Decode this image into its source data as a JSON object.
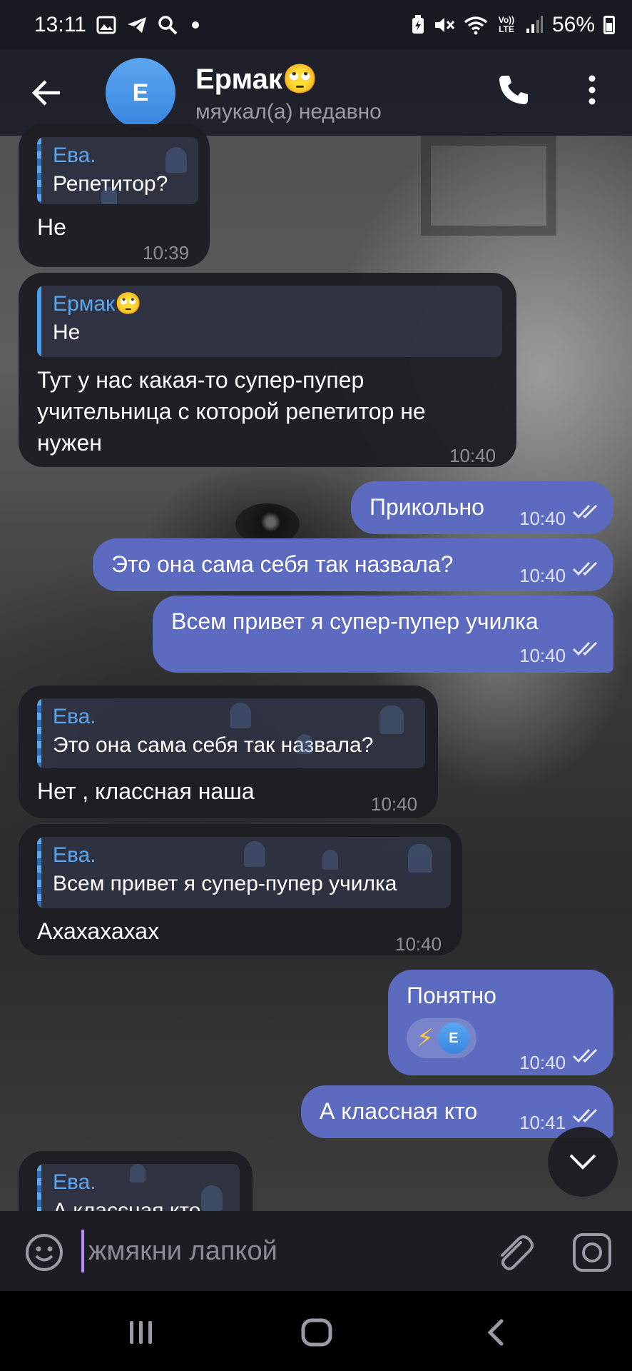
{
  "status_bar": {
    "time": "13:11",
    "battery": "56%",
    "left_icons": [
      "image-icon",
      "telegram-icon",
      "search-icon",
      "dot-icon"
    ],
    "right_icons": [
      "battery-saver-icon",
      "mute-icon",
      "wifi-icon",
      "volte-icon",
      "signal-icon"
    ],
    "volte_label": "Vo)) LTE"
  },
  "header": {
    "avatar_letter": "E",
    "title": "Ермак🙄",
    "subtitle": "мяукал(а) недавно"
  },
  "messages": [
    {
      "type": "incoming",
      "reply_name": "Ева.",
      "reply_text": "Репетитор?",
      "text": "Не",
      "time": "10:39"
    },
    {
      "type": "incoming",
      "reply_name": "Ермак🙄",
      "reply_text": "Не",
      "text": "Тут у нас какая-то супер-пупер\nучительница с которой репетитор не\nнужен",
      "time": "10:40"
    },
    {
      "type": "outgoing",
      "text": "Прикольно",
      "time": "10:40"
    },
    {
      "type": "outgoing",
      "text": "Это она сама себя так назвала?",
      "time": "10:40"
    },
    {
      "type": "outgoing",
      "text": "Всем привет я супер-пупер училка",
      "time": "10:40"
    },
    {
      "type": "incoming",
      "reply_name": "Ева.",
      "reply_text": "Это она сама себя так назвала?",
      "text": "Нет , классная наша",
      "time": "10:40"
    },
    {
      "type": "incoming",
      "reply_name": "Ева.",
      "reply_text": "Всем привет я супер-пупер училка",
      "text": "Ахахахахах",
      "time": "10:40"
    },
    {
      "type": "outgoing",
      "text": "Понятно",
      "time": "10:40",
      "reaction_emoji": "⚡",
      "reaction_avatar_letter": "E"
    },
    {
      "type": "outgoing",
      "text": "А классная кто",
      "time": "10:41"
    },
    {
      "type": "incoming",
      "reply_name": "Ева.",
      "reply_text": "А классная кто"
    }
  ],
  "input": {
    "placeholder": "жмякни лапкой"
  },
  "colors": {
    "outgoing_bubble": "#5c6bc0",
    "incoming_bubble": "#1e1e22",
    "accent": "#5aa6f0",
    "header_bg": "#1c1e28"
  }
}
